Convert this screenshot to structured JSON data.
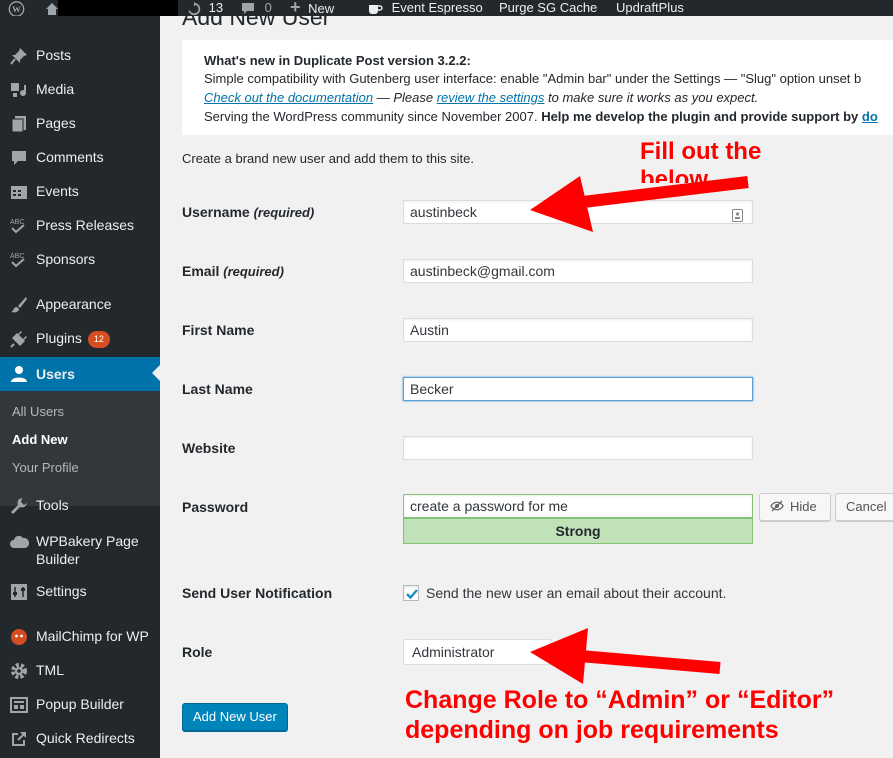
{
  "adminbar": {
    "updates_count": "13",
    "comments_count": "0",
    "new_label": "New",
    "event_espresso": "Event Espresso",
    "purge_cache": "Purge SG Cache",
    "updraftplus": "UpdraftPlus"
  },
  "sidebar": {
    "items": [
      {
        "label": "Posts",
        "icon": "pin-icon"
      },
      {
        "label": "Media",
        "icon": "media-icon"
      },
      {
        "label": "Pages",
        "icon": "page-icon"
      },
      {
        "label": "Comments",
        "icon": "comment-icon"
      },
      {
        "label": "Events",
        "icon": "calendar-icon"
      },
      {
        "label": "Press Releases",
        "icon": "abc-icon"
      },
      {
        "label": "Sponsors",
        "icon": "abc-icon"
      },
      {
        "label": "Appearance",
        "icon": "brush-icon"
      },
      {
        "label": "Plugins",
        "icon": "plug-icon",
        "badge": "12"
      },
      {
        "label": "Users",
        "icon": "user-icon"
      },
      {
        "label": "Tools",
        "icon": "wrench-icon"
      },
      {
        "label": "WPBakery Page Builder",
        "label_line1": "WPBakery Page",
        "label_line2": "Builder",
        "icon": "cloud-icon"
      },
      {
        "label": "Settings",
        "icon": "sliders-icon"
      },
      {
        "label": "MailChimp for WP",
        "icon": "mailchimp-icon"
      },
      {
        "label": "TML",
        "icon": "gear-icon"
      },
      {
        "label": "Popup Builder",
        "icon": "popup-icon"
      },
      {
        "label": "Quick Redirects",
        "icon": "external-link-icon"
      }
    ],
    "submenu": [
      "All Users",
      "Add New",
      "Your Profile"
    ]
  },
  "page": {
    "title_fragment": "Add New User"
  },
  "notice": {
    "heading": "What's new in Duplicate Post version 3.2.2:",
    "line1": "Simple compatibility with Gutenberg user interface: enable \"Admin bar\" under the Settings — \"Slug\" option unset b",
    "link1": "Check out the documentation",
    "mid1": " — Please ",
    "link2": "review the settings",
    "tail1": " to make sure it works as you expect.",
    "line3_start": "Serving the WordPress community since November 2007. ",
    "line3_bold": "Help me develop the plugin and provide support by ",
    "line3_link": "do"
  },
  "form": {
    "intro": "Create a brand new user and add them to this site.",
    "username_label": "Username",
    "required": "(required)",
    "username_value": "austinbeck",
    "email_label": "Email",
    "email_value": "austinbeck@gmail.com",
    "first_name_label": "First Name",
    "first_name_value": "Austin",
    "last_name_label": "Last Name",
    "last_name_value": "Becker",
    "website_label": "Website",
    "website_value": "",
    "password_label": "Password",
    "password_value": "create a password for me",
    "hide_label": "Hide",
    "cancel_label": "Cancel",
    "strength": "Strong",
    "notification_label": "Send User Notification",
    "notification_text": "Send the new user an email about their account.",
    "notification_checked": true,
    "role_label": "Role",
    "role_value": "Administrator",
    "submit_label": "Add New User"
  },
  "annotations": {
    "top_line1": "Fill out the",
    "top_line2": "below",
    "bottom_line1": "Change Role to “Admin” or “Editor”",
    "bottom_line2": "depending on job requirements",
    "color": "#fe0000"
  },
  "colors": {
    "sidebar_bg": "#23282d",
    "current_menu": "#0073aa",
    "submit_bg": "#0085ba",
    "strength_bg": "#c1e1b9"
  }
}
